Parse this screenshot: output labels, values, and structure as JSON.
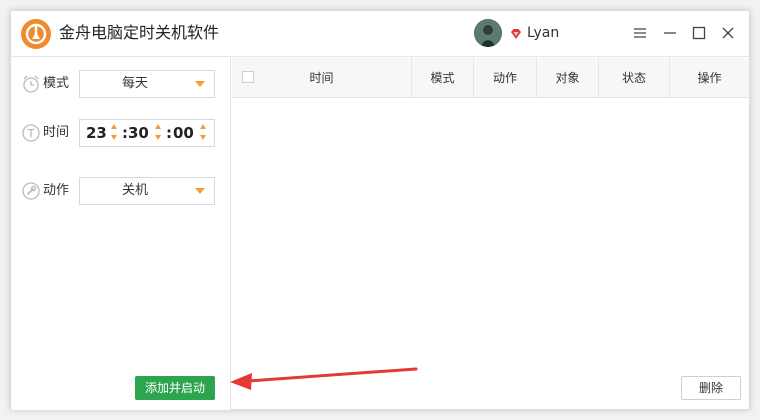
{
  "app": {
    "title": "金舟电脑定时关机软件"
  },
  "user": {
    "name": "Lyan"
  },
  "left": {
    "mode": {
      "label": "模式",
      "value": "每天"
    },
    "time": {
      "label": "时间",
      "hour": "23",
      "minute": "30",
      "second": "00"
    },
    "action": {
      "label": "动作",
      "value": "关机"
    },
    "add_button": "添加并启动"
  },
  "table": {
    "columns": [
      "时间",
      "模式",
      "动作",
      "对象",
      "状态",
      "操作"
    ],
    "rows": []
  },
  "delete_button": "删除",
  "colors": {
    "accent": "#f08a2c",
    "primary": "#2da44e",
    "annotation": "#e53935"
  }
}
